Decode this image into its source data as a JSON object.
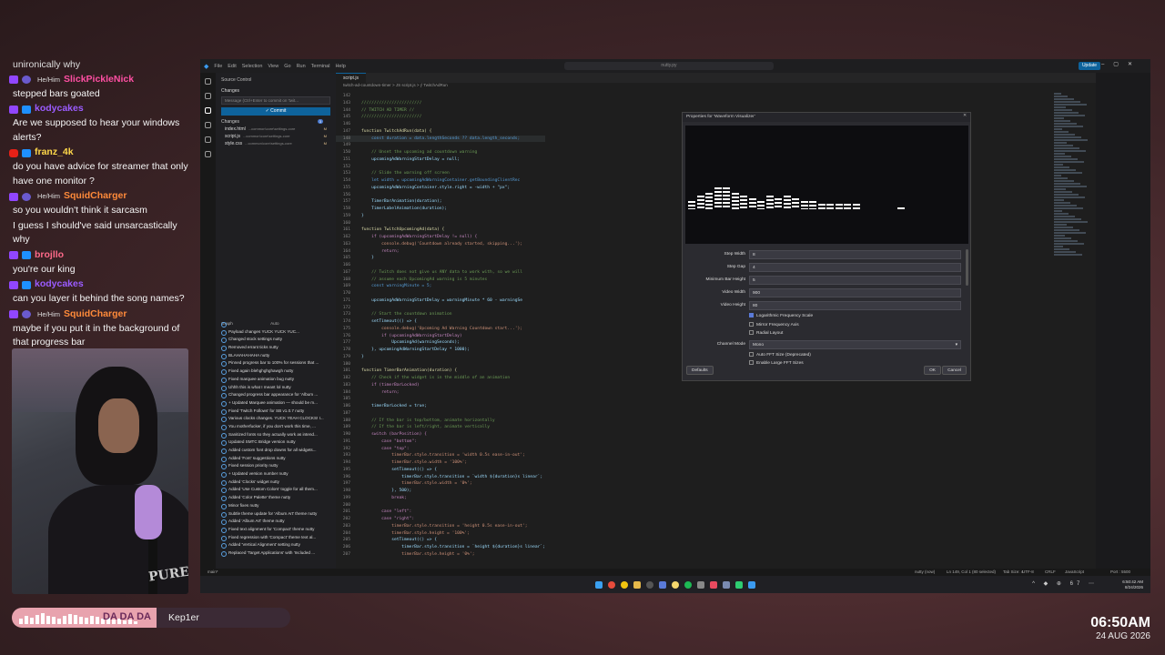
{
  "chat": {
    "top_fragment": "unironically why",
    "messages": [
      {
        "platform": "twitch",
        "pronoun": "",
        "name": "SlickPickleNick",
        "color": "#ff4fa3",
        "text": "stepped bars goated",
        "has_pronoun": true,
        "pronoun_text": "He/Him"
      },
      {
        "platform": "twitch",
        "pronoun": "",
        "name": "kodycakes",
        "color": "#9b5cff",
        "text": "Are we supposed to hear your windows alerts?",
        "has_pronoun": false,
        "pronoun_text": ""
      },
      {
        "platform": "youtube",
        "pronoun": "",
        "name": "franz_4k",
        "color": "#ffd84a",
        "text": "do you have advice for streamer that only have one monitor ?",
        "has_pronoun": false,
        "pronoun_text": ""
      },
      {
        "platform": "twitch",
        "pronoun": "",
        "name": "SquidCharger",
        "color": "#ff8a3a",
        "text": "so you wouldn't think it sarcasm",
        "has_pronoun": true,
        "pronoun_text": "He/Him"
      },
      {
        "platform": "none",
        "pronoun": "",
        "name": "",
        "color": "#ffffff",
        "text": "I guess I should've said unsarcastically why",
        "has_pronoun": false,
        "pronoun_text": ""
      },
      {
        "platform": "twitch",
        "pronoun": "",
        "name": "brojllo",
        "color": "#ff6a8a",
        "text": "you're our king",
        "has_pronoun": false,
        "pronoun_text": ""
      },
      {
        "platform": "twitch",
        "pronoun": "",
        "name": "kodycakes",
        "color": "#9b5cff",
        "text": "can you layer it behind the song names?",
        "has_pronoun": false,
        "pronoun_text": ""
      },
      {
        "platform": "twitch",
        "pronoun": "",
        "name": "SquidCharger",
        "color": "#ff8a3a",
        "text": "maybe if you put it in the background of that progress bar",
        "has_pronoun": true,
        "pronoun_text": "He/Him"
      }
    ]
  },
  "webcam": {
    "shirt_text": "PURES"
  },
  "now_playing": {
    "song": "DA DA DA",
    "artist": "Kep1er",
    "progress": 0.52
  },
  "clock": {
    "time": "06:50AM",
    "date": "24 AUG 2026"
  },
  "vscode": {
    "menu": [
      "File",
      "Edit",
      "Selection",
      "View",
      "Go",
      "Run",
      "Terminal",
      "Help"
    ],
    "command_center": "nutty.py",
    "update_button": "Update",
    "sidebar": {
      "title": "Source Control",
      "section": "Changes",
      "message_placeholder": "Message (Ctrl+Enter to commit on 'twit...",
      "commit_label": "✓ Commit",
      "changes_label": "Changes",
      "changes_count": "3",
      "files": [
        {
          "name": "index.html",
          "path": "...common\\core\\settings-core",
          "status": "M"
        },
        {
          "name": "script.js",
          "path": "...common\\core\\settings-core",
          "status": "M"
        },
        {
          "name": "style.css",
          "path": "...common\\core\\settings-core",
          "status": "M"
        }
      ],
      "graph_title": "Graph",
      "graph_auto": "Auto",
      "graph_items": [
        "Payload changes YUCK YUCK YUC...",
        "Changed stock settings nutty",
        "Removed errant ticks nutty",
        "BLAHAHAHAHA nutty",
        "Pinned progress bar to 100% for sessions that ...",
        "Fixed again blehghghghawgh nutty",
        "Fixed marquee animation bug nutty",
        "Uhhh this is what I meant lol nutty",
        "Changed progress bar appearance for 'Album ...",
        "+ Updated Marquee animation — should be m...",
        "Fixed 'Twitch Follows' for SB v1.0.7 nutty",
        "Various clocks changes. YUCK YEAH CLOCKS! I...",
        "You motherfucker, if you don't work this time, ...",
        "Sanitized fonts so they actually work as intend...",
        "Updated SMTC Bridge version nutty",
        "Added custom font drop downs for all widgets...",
        "Added 'Font' suggestions nutty",
        "Fixed session priority nutty",
        "+ Updated version number nutty",
        "Added 'Clocks' widget nutty",
        "Added 'Use Custom Colors' toggle for all them...",
        "Added 'Color Palette' theme nutty",
        "Minor fixes nutty",
        "Subtle theme update for 'Album Art' theme nutty",
        "Added 'Album Art' theme nutty",
        "Fixed text alignment for 'Compact' theme nutty",
        "Fixed regression with 'Compact' theme text al...",
        "Added 'Vertical Alignment' setting nutty",
        "Replaced 'Target Applications' with 'Included ..."
      ]
    },
    "tab": "script.js",
    "breadcrumb": "twitch-ad-countdown-timer > JS script.js > ⨍ TwitchAdRun",
    "code_lines": [
      {
        "n": "142",
        "t": ""
      },
      {
        "n": "143",
        "t": "////////////////////////"
      },
      {
        "n": "144",
        "t": "// TWITCH AD TIMER //"
      },
      {
        "n": "145",
        "t": "////////////////////////"
      },
      {
        "n": "146",
        "t": ""
      },
      {
        "n": "147",
        "t": "function TwitchAdRun(data) {"
      },
      {
        "n": "148",
        "t": "    const duration = data.lengthSeconds ?? data.length_seconds;"
      },
      {
        "n": "149",
        "t": ""
      },
      {
        "n": "150",
        "t": "    // Unset the upcoming ad countdown warning"
      },
      {
        "n": "151",
        "t": "    upcomingAdWarningStartDelay = null;"
      },
      {
        "n": "152",
        "t": ""
      },
      {
        "n": "153",
        "t": "    // Slide the warning off screen"
      },
      {
        "n": "154",
        "t": "    let width = upcomingAdWarningContainer.getBoundingClientRec"
      },
      {
        "n": "155",
        "t": "    upcomingAdWarningContainer.style.right = -width + \"px\";"
      },
      {
        "n": "156",
        "t": ""
      },
      {
        "n": "157",
        "t": "    TimerBarAnimation(duration);"
      },
      {
        "n": "158",
        "t": "    TimerLabelAnimation(duration);"
      },
      {
        "n": "159",
        "t": "}"
      },
      {
        "n": "160",
        "t": ""
      },
      {
        "n": "161",
        "t": "function TwitchUpcomingAd(data) {"
      },
      {
        "n": "162",
        "t": "    if (upcomingAdWarningStartDelay != null) {"
      },
      {
        "n": "163",
        "t": "        console.debug('Countdown already started, skipping...');"
      },
      {
        "n": "164",
        "t": "        return;"
      },
      {
        "n": "165",
        "t": "    }"
      },
      {
        "n": "166",
        "t": ""
      },
      {
        "n": "167",
        "t": "    // Twitch does not give us ANY data to work with, so we will"
      },
      {
        "n": "168",
        "t": "    // assume each UpcomingAd warning is 5 minutes"
      },
      {
        "n": "169",
        "t": "    const warningMinute = 5;"
      },
      {
        "n": "170",
        "t": ""
      },
      {
        "n": "171",
        "t": "    upcomingAdWarningStartDelay = warningMinute * 60 - warningSe"
      },
      {
        "n": "172",
        "t": ""
      },
      {
        "n": "173",
        "t": "    // Start the countdown animation"
      },
      {
        "n": "174",
        "t": "    setTimeout(() => {"
      },
      {
        "n": "175",
        "t": "        console.debug('Upcoming Ad Warning Countdown start...');"
      },
      {
        "n": "176",
        "t": "        if (upcomingAdWarningStartDelay)"
      },
      {
        "n": "177",
        "t": "            UpcomingAd(warningSeconds);"
      },
      {
        "n": "178",
        "t": "    }, upcomingAdWarningStartDelay * 1000);"
      },
      {
        "n": "179",
        "t": "}"
      },
      {
        "n": "180",
        "t": ""
      },
      {
        "n": "181",
        "t": "function TimerBarAnimation(duration) {"
      },
      {
        "n": "182",
        "t": "    // Check if the widget is in the middle of an animation"
      },
      {
        "n": "183",
        "t": "    if (timerBarLocked)"
      },
      {
        "n": "184",
        "t": "        return;"
      },
      {
        "n": "185",
        "t": ""
      },
      {
        "n": "186",
        "t": "    timerBarLocked = true;"
      },
      {
        "n": "187",
        "t": ""
      },
      {
        "n": "188",
        "t": "    // If the bar is top/bottom, animate horizontally"
      },
      {
        "n": "189",
        "t": "    // If the bar is left/right, animate vertically"
      },
      {
        "n": "190",
        "t": "    switch (barPosition) {"
      },
      {
        "n": "191",
        "t": "        case \"bottom\":"
      },
      {
        "n": "192",
        "t": "        case \"top\":"
      },
      {
        "n": "193",
        "t": "            timerBar.style.transition = 'width 0.5s ease-in-out';"
      },
      {
        "n": "194",
        "t": "            timerBar.style.width = '100%';"
      },
      {
        "n": "195",
        "t": "            setTimeout(() => {"
      },
      {
        "n": "196",
        "t": "                timerBar.style.transition = `width ${duration}s linear`;"
      },
      {
        "n": "197",
        "t": "                timerBar.style.width = '0%';"
      },
      {
        "n": "198",
        "t": "            }, 500);"
      },
      {
        "n": "199",
        "t": "            break;"
      },
      {
        "n": "200",
        "t": ""
      },
      {
        "n": "201",
        "t": "        case \"left\":"
      },
      {
        "n": "202",
        "t": "        case \"right\":"
      },
      {
        "n": "203",
        "t": "            timerBar.style.transition = 'height 0.5s ease-in-out';"
      },
      {
        "n": "204",
        "t": "            timerBar.style.height = '100%';"
      },
      {
        "n": "205",
        "t": "            setTimeout(() => {"
      },
      {
        "n": "206",
        "t": "                timerBar.style.transition = `height ${duration}s linear`;"
      },
      {
        "n": "207",
        "t": "                timerBar.style.height = '0%';"
      }
    ],
    "status": {
      "branch": "main*",
      "user": "nutty (now)",
      "position": "Ln 149, Col 1 (80 selected)",
      "tab_size": "Tab Size: 4",
      "encoding": "UTF-8",
      "eol": "CRLF",
      "language": "JavaScript",
      "port": "Port : 5500"
    }
  },
  "obs_dialog": {
    "title": "Properties for 'Waveform Visualizer'",
    "waveform_levels": [
      0.3,
      0.5,
      0.6,
      0.8,
      0.8,
      0.6,
      0.5,
      0.4,
      0.3,
      0.5,
      0.4,
      0.5,
      0.4,
      0.3,
      0.3,
      0.2,
      0.2,
      0.2,
      0.2,
      0.2
    ],
    "fields": [
      {
        "label": "Step Width",
        "value": "8"
      },
      {
        "label": "Step Gap",
        "value": "4"
      },
      {
        "label": "Minimum Bar Height",
        "value": "5"
      },
      {
        "label": "Video Width",
        "value": "900"
      },
      {
        "label": "Video Height",
        "value": "80"
      }
    ],
    "checks": [
      {
        "label": "Logarithmic Frequency Scale",
        "checked": true
      },
      {
        "label": "Mirror Frequency Axis",
        "checked": false
      },
      {
        "label": "Radial Layout",
        "checked": false
      }
    ],
    "channel_mode_label": "Channel Mode",
    "channel_mode_value": "Mono",
    "checks2": [
      {
        "label": "Auto FFT Size (Deprecated)",
        "checked": false
      },
      {
        "label": "Enable Large FFT Sizes",
        "checked": false
      }
    ],
    "defaults_btn": "Defaults",
    "ok_btn": "OK",
    "cancel_btn": "Cancel"
  },
  "taskbar": {
    "tray_time": "6:50:42 AM",
    "tray_date": "8/24/2026",
    "tray_misc": "67"
  },
  "colors": {
    "accent": "#0e639c",
    "pink_bar": "#e8a3ae"
  }
}
